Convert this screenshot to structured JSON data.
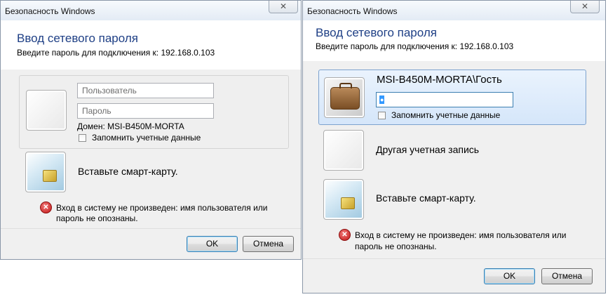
{
  "left": {
    "window_title": "Безопасность Windows",
    "close_glyph": "✕",
    "heading": "Ввод сетевого пароля",
    "subheading": "Введите пароль для подключения к: 192.168.0.103",
    "username_placeholder": "Пользователь",
    "password_placeholder": "Пароль",
    "domain_text": "Домен: MSI-B450M-MORTA",
    "remember_label": "Запомнить учетные данные",
    "smartcard_label": "Вставьте смарт-карту.",
    "error_lines": [
      "Вход в систему не произведен: имя пользователя или",
      "пароль не опознаны."
    ],
    "ok_label": "OK",
    "cancel_label": "Отмена"
  },
  "right": {
    "window_title": "Безопасность Windows",
    "close_glyph": "✕",
    "heading": "Ввод сетевого пароля",
    "subheading": "Введите пароль для подключения к: 192.168.0.103",
    "account_name": "MSI-B450M-MORTA\\Гость",
    "password_value": "●",
    "remember_label": "Запомнить учетные данные",
    "other_account_label": "Другая учетная запись",
    "smartcard_label": "Вставьте смарт-карту.",
    "error_lines": [
      "Вход в систему не произведен: имя пользователя или",
      "пароль не опознаны."
    ],
    "ok_label": "OK",
    "cancel_label": "Отмена"
  },
  "error_icon_glyph": "✕",
  "colors": {
    "heading": "#1e3f85",
    "selection": "#dcebfc",
    "default_button_border": "#3c7fb1"
  }
}
